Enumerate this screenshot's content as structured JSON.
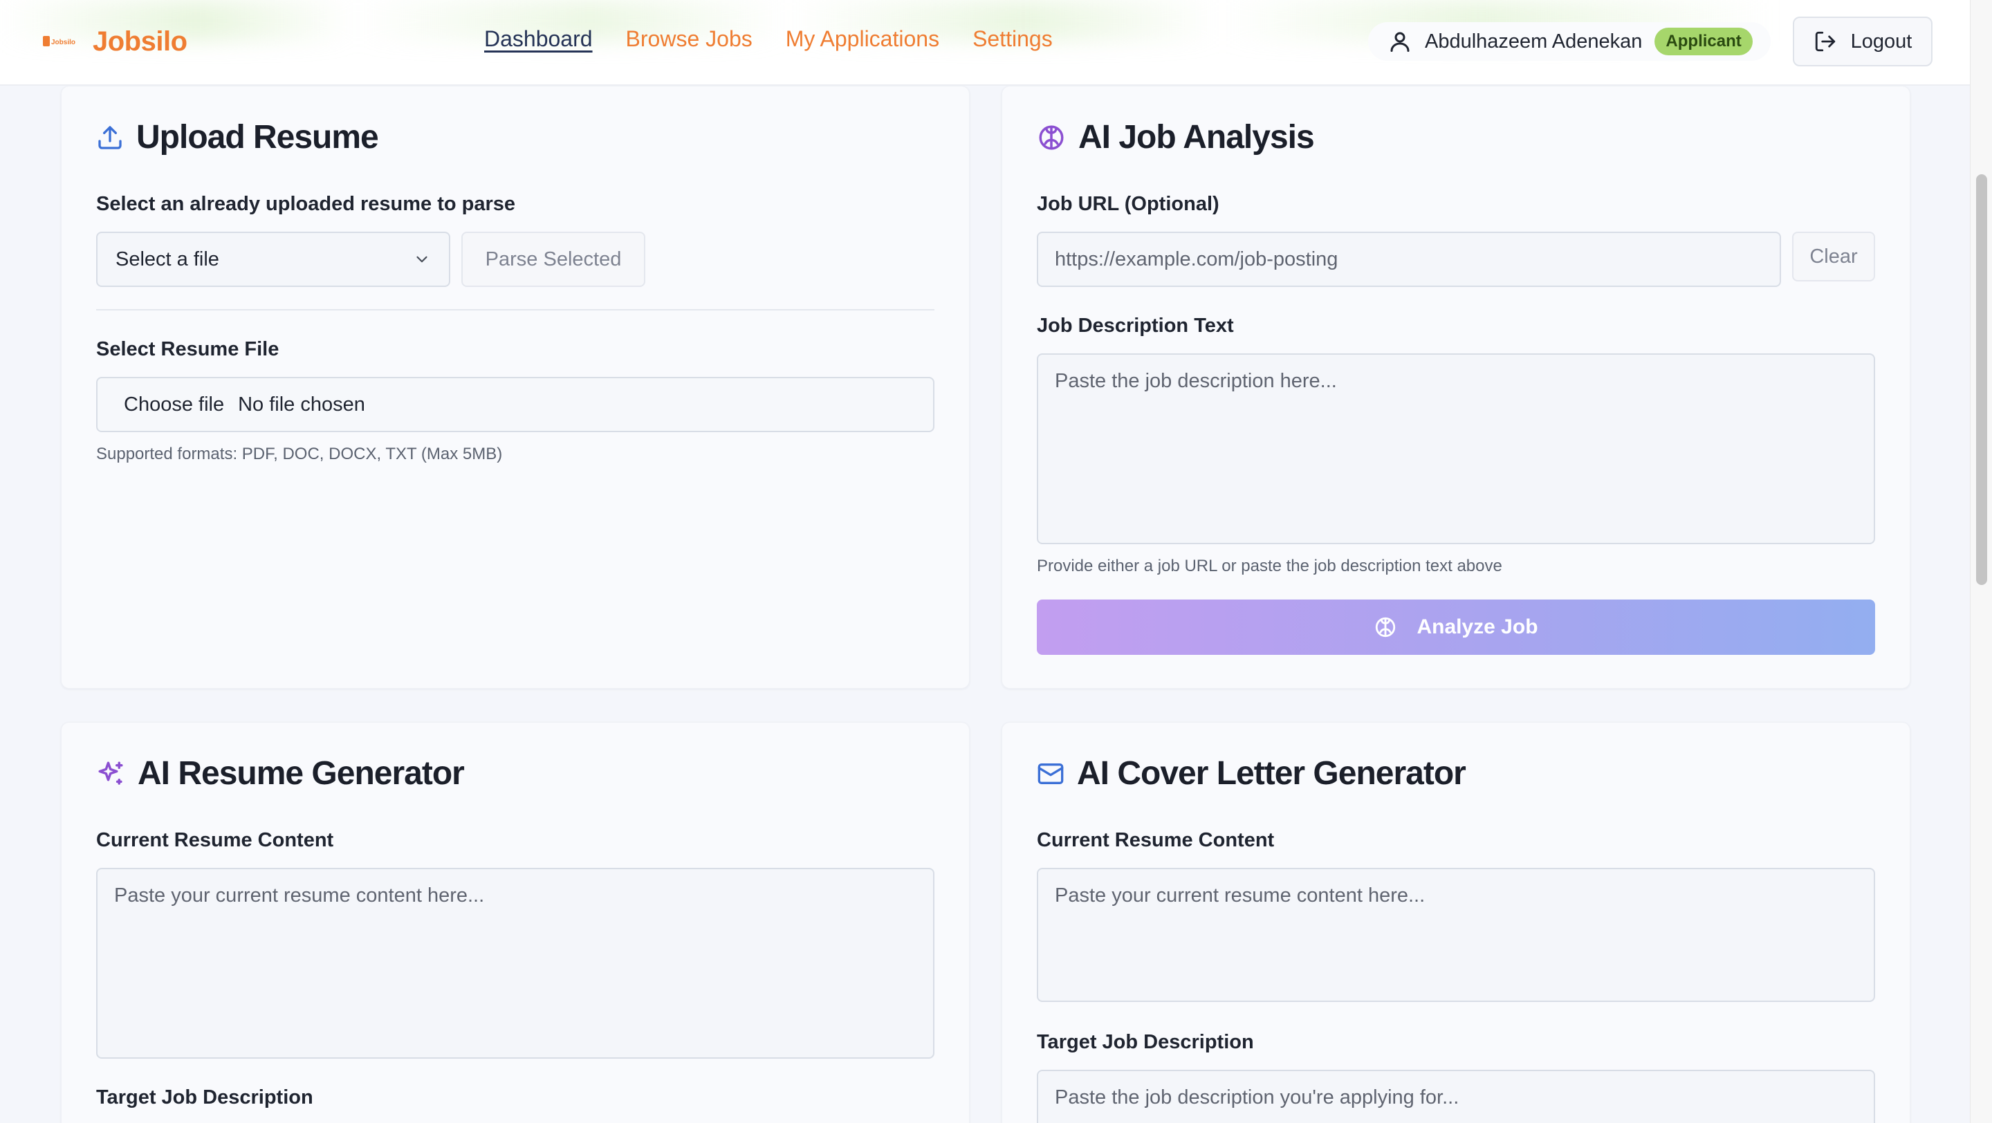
{
  "header": {
    "brand_name": "Jobsilo",
    "brand_logo_text": "Jobsilo",
    "nav": [
      {
        "label": "Dashboard"
      },
      {
        "label": "Browse Jobs"
      },
      {
        "label": "My Applications"
      },
      {
        "label": "Settings"
      }
    ],
    "user_name": "Abdulhazeem Adenekan",
    "role_badge": "Applicant",
    "logout_label": "Logout"
  },
  "upload_resume": {
    "title": "Upload Resume",
    "select_label": "Select an already uploaded resume to parse",
    "select_value": "Select a file",
    "parse_button": "Parse Selected",
    "file_label": "Select Resume File",
    "choose_file": "Choose file",
    "no_file": "No file chosen",
    "formats_hint": "Supported formats: PDF, DOC, DOCX, TXT (Max 5MB)"
  },
  "job_analysis": {
    "title": "AI Job Analysis",
    "url_label": "Job URL (Optional)",
    "url_placeholder": "https://example.com/job-posting",
    "clear_button": "Clear",
    "desc_label": "Job Description Text",
    "desc_placeholder": "Paste the job description here...",
    "hint": "Provide either a job URL or paste the job description text above",
    "analyze_button": "Analyze Job"
  },
  "resume_generator": {
    "title": "AI Resume Generator",
    "content_label": "Current Resume Content",
    "content_placeholder": "Paste your current resume content here...",
    "target_label": "Target Job Description"
  },
  "cover_letter": {
    "title": "AI Cover Letter Generator",
    "content_label": "Current Resume Content",
    "content_placeholder": "Paste your current resume content here...",
    "target_label": "Target Job Description",
    "target_placeholder": "Paste the job description you're applying for..."
  },
  "colors": {
    "brand_orange": "#ef7d32",
    "active_nav": "#253356",
    "badge_green": "#a6d66b",
    "upload_icon": "#3b6fd6",
    "brain_icon": "#8b4fd1",
    "sparkle_icon": "#8b4fd1",
    "mail_icon": "#3b6fd6"
  },
  "icons": {
    "upload": "upload-icon",
    "brain": "brain-icon",
    "sparkles": "sparkles-icon",
    "mail": "mail-icon",
    "user": "user-icon",
    "logout": "logout-icon",
    "chevron": "chevron-down-icon"
  }
}
